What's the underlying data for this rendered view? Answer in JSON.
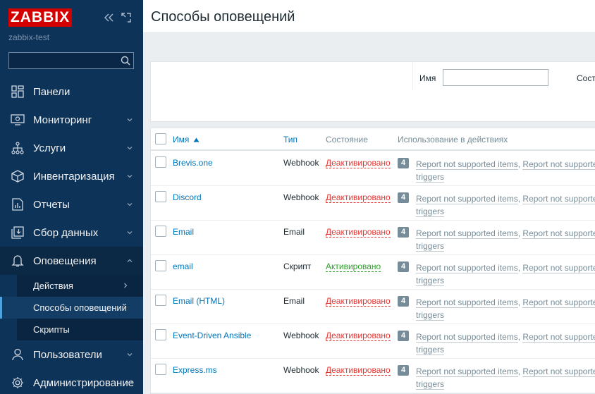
{
  "sidebar": {
    "logo": "ZABBIX",
    "server": "zabbix-test",
    "search": {
      "value": "",
      "placeholder": ""
    },
    "menu": [
      {
        "label": "Панели",
        "icon": "dashboard-icon"
      },
      {
        "label": "Мониторинг",
        "icon": "monitoring-icon"
      },
      {
        "label": "Услуги",
        "icon": "services-icon"
      },
      {
        "label": "Инвентаризация",
        "icon": "inventory-icon"
      },
      {
        "label": "Отчеты",
        "icon": "reports-icon"
      },
      {
        "label": "Сбор данных",
        "icon": "data-collection-icon"
      },
      {
        "label": "Оповещения",
        "icon": "bell-icon"
      },
      {
        "label": "Пользователи",
        "icon": "users-icon"
      },
      {
        "label": "Администрирование",
        "icon": "gear-icon"
      }
    ],
    "submenu": [
      {
        "label": "Действия"
      },
      {
        "label": "Способы оповещений"
      },
      {
        "label": "Скрипты"
      }
    ]
  },
  "header": {
    "title": "Способы оповещений"
  },
  "filter": {
    "name_label": "Имя",
    "name_value": "",
    "status_label": "Сост"
  },
  "table": {
    "columns": {
      "name": "Имя",
      "type": "Тип",
      "status": "Состояние",
      "usage": "Использование в действиях"
    },
    "rows": [
      {
        "name": "Brevis.one",
        "type": "Webhook",
        "status": "Деактивировано",
        "count": "4",
        "usage1": "Report not supported items",
        "sep": ", ",
        "usage2": "Report not supported",
        "usage3": "triggers"
      },
      {
        "name": "Discord",
        "type": "Webhook",
        "status": "Деактивировано",
        "count": "4",
        "usage1": "Report not supported items",
        "sep": ", ",
        "usage2": "Report not supported",
        "usage3": "triggers"
      },
      {
        "name": "Email",
        "type": "Email",
        "status": "Деактивировано",
        "count": "4",
        "usage1": "Report not supported items",
        "sep": ", ",
        "usage2": "Report not supported",
        "usage3": "triggers"
      },
      {
        "name": "email",
        "type": "Скрипт",
        "status": "Активировано",
        "count": "4",
        "usage1": "Report not supported items",
        "sep": ", ",
        "usage2": "Report not supported",
        "usage3": "triggers"
      },
      {
        "name": "Email (HTML)",
        "type": "Email",
        "status": "Деактивировано",
        "count": "4",
        "usage1": "Report not supported items",
        "sep": ", ",
        "usage2": "Report not supported",
        "usage3": "triggers"
      },
      {
        "name": "Event-Driven Ansible",
        "type": "Webhook",
        "status": "Деактивировано",
        "count": "4",
        "usage1": "Report not supported items",
        "sep": ", ",
        "usage2": "Report not supported",
        "usage3": "triggers"
      },
      {
        "name": "Express.ms",
        "type": "Webhook",
        "status": "Деактивировано",
        "count": "4",
        "usage1": "Report not supported items",
        "sep": ", ",
        "usage2": "Report not supported",
        "usage3": "triggers"
      }
    ]
  },
  "colors": {
    "sidebar_bg": "#0e3359",
    "logo_red": "#d40000",
    "link_blue": "#0275b8",
    "status_disabled": "#e33734",
    "status_enabled": "#2f9f2f"
  }
}
